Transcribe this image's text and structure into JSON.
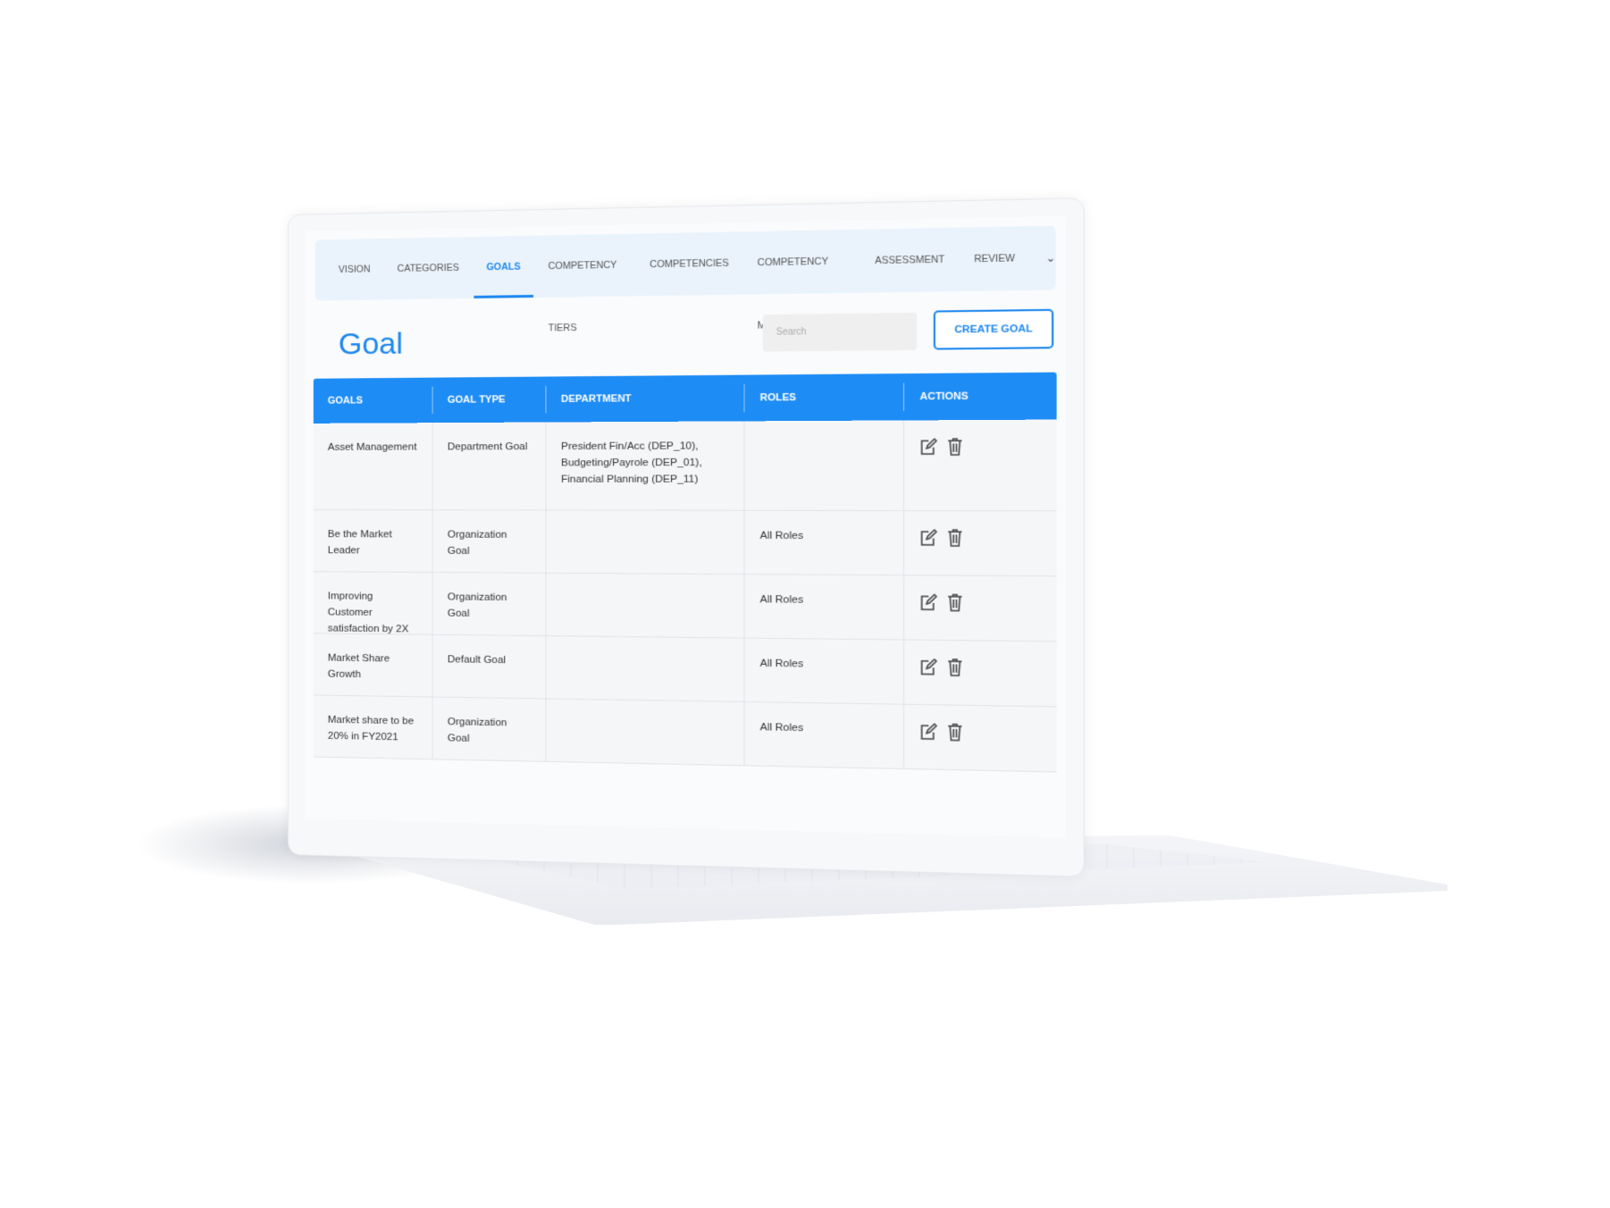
{
  "nav": {
    "tabs": [
      "VISION",
      "CATEGORIES",
      "GOALS",
      "COMPETENCY TIERS",
      "COMPETENCIES",
      "COMPETENCY MAPPING",
      "ASSESSMENT",
      "REVIEW CYCLE"
    ],
    "active": "GOALS"
  },
  "page": {
    "title": "Goal",
    "search_placeholder": "Search",
    "create_label": "CREATE GOAL"
  },
  "table": {
    "headers": [
      "GOALS",
      "GOAL TYPE",
      "DEPARTMENT",
      "ROLES",
      "ACTIONS"
    ],
    "rows": [
      {
        "goal": "Asset Management",
        "type": "Department Goal",
        "department": "President Fin/Acc (DEP_10), Budgeting/Payrole (DEP_01), Financial Planning (DEP_11)",
        "roles": ""
      },
      {
        "goal": "Be the Market Leader",
        "type": "Organization Goal",
        "department": "",
        "roles": "All Roles"
      },
      {
        "goal": "Improving Customer satisfaction by 2X",
        "type": "Organization Goal",
        "department": "",
        "roles": "All Roles"
      },
      {
        "goal": "Market Share Growth",
        "type": "Default Goal",
        "department": "",
        "roles": "All Roles"
      },
      {
        "goal": "Market share to be 20% in FY2021",
        "type": "Organization Goal",
        "department": "",
        "roles": "All Roles"
      }
    ]
  },
  "colors": {
    "accent": "#1e88f0",
    "header_bg": "#1e8cf5",
    "nav_bg": "#eaf3fc"
  }
}
